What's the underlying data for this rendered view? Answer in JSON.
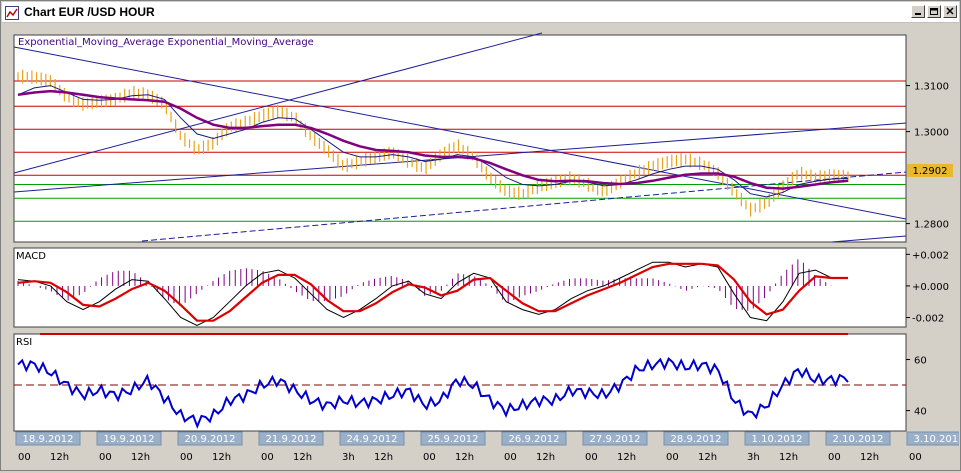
{
  "window": {
    "title": "Chart EUR /USD  HOUR",
    "icons": {
      "app": "chart-icon",
      "minimize": "minimize-icon",
      "restore": "restore-icon",
      "close": "close-icon"
    }
  },
  "colors": {
    "price_bars": "#e8a21c",
    "ema_fast": "#1a1a80",
    "ema_slow": "#800080",
    "horizontal_red": "#cc0000",
    "horizontal_green": "#00a000",
    "trendline": "#1e1e9a",
    "macd_signal": "#dd0000",
    "macd_hist": "#800080",
    "rsi_line": "#0000cc",
    "rsi_midline": "#800000",
    "rsi_upper": "#cc0000",
    "price_tag": "#e8b830",
    "date_tab": "#9ab0c8"
  },
  "chart_data": [
    {
      "type": "line",
      "panel": "price",
      "legend_text": "Exponential_Moving_Average Exponential_Moving_Average",
      "y_ticks": [
        "1.3100",
        "1.3000",
        "1.2800"
      ],
      "ylim": [
        1.276,
        1.321
      ],
      "last_price": "1.2902",
      "red_levels": [
        1.311,
        1.3055,
        1.3005,
        1.2955,
        1.2905
      ],
      "green_levels": [
        1.2885,
        1.2855,
        1.2805
      ],
      "series": [
        {
          "role": "price",
          "values": [
            1.312,
            1.3118,
            1.311,
            1.3075,
            1.306,
            1.3065,
            1.307,
            1.3085,
            1.308,
            1.306,
            1.299,
            1.296,
            1.2975,
            1.301,
            1.302,
            1.3035,
            1.3045,
            1.303,
            1.299,
            1.296,
            1.2925,
            1.2935,
            1.2945,
            1.2955,
            1.2935,
            1.292,
            1.295,
            1.297,
            1.2945,
            1.29,
            1.287,
            1.2865,
            1.288,
            1.289,
            1.29,
            1.2885,
            1.287,
            1.289,
            1.291,
            1.2925,
            1.2935,
            1.294,
            1.293,
            1.291,
            1.287,
            1.283,
            1.2845,
            1.288,
            1.291,
            1.29,
            1.2905,
            1.2902
          ]
        },
        {
          "role": "ema_fast",
          "values": [
            1.308,
            1.3095,
            1.31,
            1.3085,
            1.307,
            1.3068,
            1.307,
            1.3078,
            1.308,
            1.307,
            1.303,
            1.2995,
            1.2985,
            1.2995,
            1.3005,
            1.302,
            1.303,
            1.3028,
            1.3005,
            1.298,
            1.2955,
            1.2945,
            1.2945,
            1.295,
            1.2945,
            1.2935,
            1.294,
            1.295,
            1.2945,
            1.2925,
            1.29,
            1.2885,
            1.2882,
            1.2885,
            1.2892,
            1.289,
            1.2882,
            1.2885,
            1.2895,
            1.2908,
            1.2918,
            1.2925,
            1.2925,
            1.2918,
            1.2895,
            1.2865,
            1.2858,
            1.2868,
            1.2885,
            1.2892,
            1.2897,
            1.2898
          ]
        },
        {
          "role": "ema_slow",
          "values": [
            1.308,
            1.3085,
            1.3088,
            1.3085,
            1.308,
            1.3075,
            1.3072,
            1.307,
            1.3068,
            1.3065,
            1.305,
            1.303,
            1.3015,
            1.3008,
            1.3008,
            1.3012,
            1.3015,
            1.3015,
            1.3008,
            1.2995,
            1.298,
            1.2968,
            1.296,
            1.2958,
            1.2955,
            1.2948,
            1.2945,
            1.2945,
            1.2942,
            1.2932,
            1.2918,
            1.2905,
            1.2895,
            1.2892,
            1.2893,
            1.2892,
            1.2888,
            1.2886,
            1.2888,
            1.2893,
            1.29,
            1.2906,
            1.2909,
            1.2909,
            1.2902,
            1.2888,
            1.2878,
            1.2876,
            1.288,
            1.2885,
            1.289,
            1.2893
          ]
        }
      ]
    },
    {
      "type": "bar",
      "panel": "macd",
      "legend_text": "MACD",
      "y_ticks": [
        "+0.002",
        "+0.000",
        "-0.002"
      ],
      "ylim": [
        -0.0026,
        0.0024
      ],
      "series": [
        {
          "role": "macd",
          "values": [
            0.0004,
            0.0003,
            0.0,
            -0.001,
            -0.0015,
            -0.001,
            -0.0002,
            0.0004,
            0.0003,
            -0.0008,
            -0.002,
            -0.0025,
            -0.002,
            -0.001,
            0.0,
            0.0008,
            0.001,
            0.0005,
            -0.0005,
            -0.0015,
            -0.002,
            -0.0015,
            -0.0008,
            0.0,
            0.0003,
            -0.0005,
            -0.0008,
            0.0002,
            0.0008,
            0.0005,
            -0.001,
            -0.0015,
            -0.0018,
            -0.0015,
            -0.0008,
            -0.0003,
            0.0,
            0.0005,
            0.001,
            0.0015,
            0.0015,
            0.0012,
            0.0014,
            0.0012,
            -0.0005,
            -0.002,
            -0.0022,
            -0.001,
            0.0008,
            0.001,
            0.0005,
            0.0005
          ]
        },
        {
          "role": "signal",
          "values": [
            0.0002,
            0.0003,
            0.0002,
            -0.0004,
            -0.0012,
            -0.0013,
            -0.0008,
            -0.0002,
            0.0002,
            -0.0003,
            -0.0012,
            -0.0022,
            -0.0022,
            -0.0016,
            -0.0007,
            0.0002,
            0.0007,
            0.0007,
            0.0001,
            -0.0009,
            -0.0016,
            -0.0016,
            -0.0011,
            -0.0004,
            0.0001,
            -0.0001,
            -0.0006,
            -0.0003,
            0.0004,
            0.0005,
            -0.0003,
            -0.0011,
            -0.0016,
            -0.0016,
            -0.0011,
            -0.0006,
            -0.0002,
            0.0002,
            0.0007,
            0.0012,
            0.0014,
            0.0014,
            0.0014,
            0.0013,
            0.0004,
            -0.001,
            -0.0018,
            -0.0015,
            -0.0003,
            0.0006,
            0.0005,
            0.0005
          ]
        }
      ]
    },
    {
      "type": "line",
      "panel": "rsi",
      "legend_text": "RSI",
      "y_ticks": [
        "60",
        "40"
      ],
      "ylim": [
        32,
        70
      ],
      "levels": {
        "upper": 70,
        "middle": 50
      },
      "series": [
        {
          "role": "rsi",
          "values": [
            58,
            58,
            55,
            50,
            46,
            48,
            46,
            48,
            52,
            45,
            38,
            36,
            38,
            44,
            46,
            50,
            52,
            48,
            44,
            42,
            44,
            43,
            44,
            46,
            48,
            42,
            44,
            52,
            50,
            44,
            40,
            42,
            44,
            44,
            48,
            47,
            46,
            50,
            56,
            58,
            59,
            57,
            58,
            56,
            44,
            38,
            42,
            50,
            56,
            52,
            52,
            53
          ]
        }
      ]
    }
  ],
  "x_axis": {
    "dates": [
      "18.9.2012",
      "19.9.2012",
      "20.9.2012",
      "21.9.2012",
      "24.9.2012",
      "25.9.2012",
      "26.9.2012",
      "27.9.2012",
      "28.9.2012",
      "1.10.2012",
      "2.10.2012",
      "3.10.2012"
    ],
    "hour_labels": [
      [
        "00",
        "12h"
      ],
      [
        "00",
        "12h"
      ],
      [
        "00",
        "12h"
      ],
      [
        "00",
        "12h"
      ],
      [
        "3h",
        "12h"
      ],
      [
        "00",
        "12h"
      ],
      [
        "00",
        "12h"
      ],
      [
        "00",
        "12h"
      ],
      [
        "00",
        "12h"
      ],
      [
        "3h",
        "12h"
      ],
      [
        "00",
        "12h"
      ],
      [
        "00"
      ]
    ]
  }
}
